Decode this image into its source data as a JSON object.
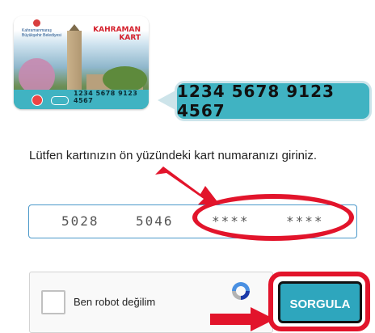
{
  "card": {
    "number": "1234 5678 9123 4567",
    "brand_line1": "KAHRAMAN",
    "brand_line2": "KART",
    "logo_text": "Kahramanmaraş Büyükşehir Belediyesi"
  },
  "callout": {
    "number": "1234 5678 9123 4567"
  },
  "instruction": "Lütfen kartınızın ön yüzündeki kart numaranızı giriniz.",
  "card_input": {
    "group1": "5028",
    "group2": "5046",
    "group3": "****",
    "group4": "****"
  },
  "captcha": {
    "label": "Ben robot değilim"
  },
  "submit_label": "SORGULA",
  "colors": {
    "accent": "#2ea6bd",
    "card_teal": "#40b3c2",
    "highlight_red": "#e2142b"
  }
}
